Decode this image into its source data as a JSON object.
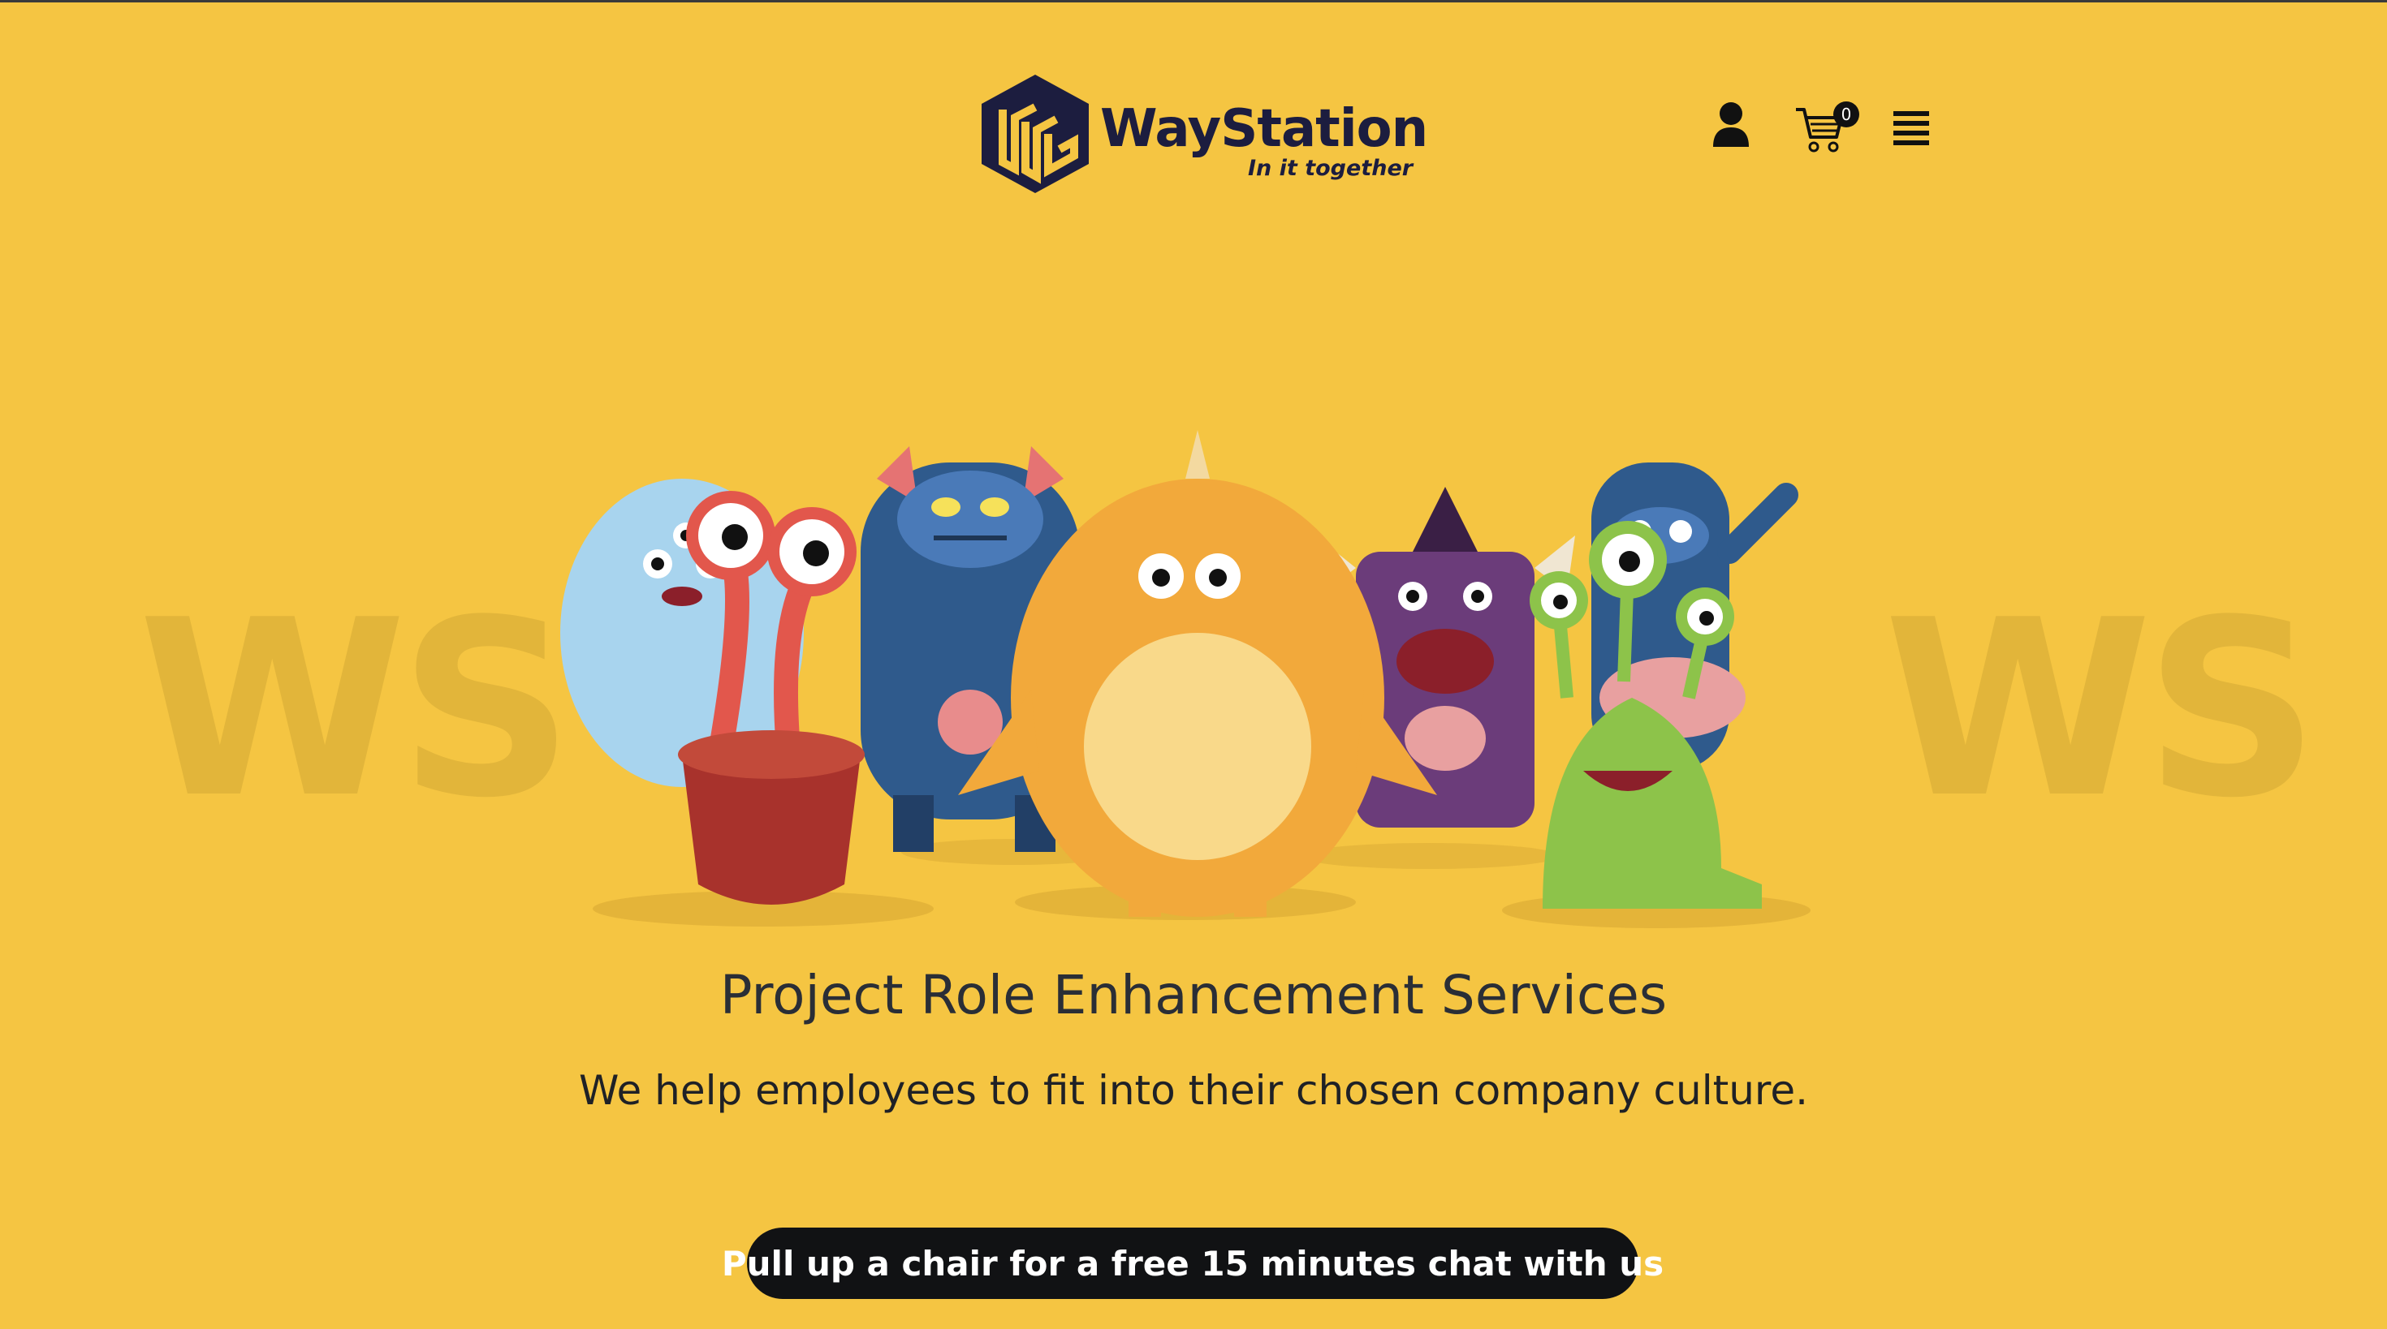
{
  "header": {
    "brand_name": "WayStation",
    "brand_tagline": "In it together",
    "cart_count": "0",
    "icons": [
      "account-icon",
      "cart-icon",
      "menu-icon"
    ]
  },
  "hero": {
    "watermark_left": "WS",
    "watermark_right": "WS",
    "title": "Project Role Enhancement Services",
    "subtitle": "We help employees to fit into their chosen company culture.",
    "cta_label": "Pull up a chair for a free 15 minutes chat with us"
  },
  "colors": {
    "background": "#f5c542",
    "brand_navy": "#1c1d3f",
    "cta_background": "#111214"
  }
}
